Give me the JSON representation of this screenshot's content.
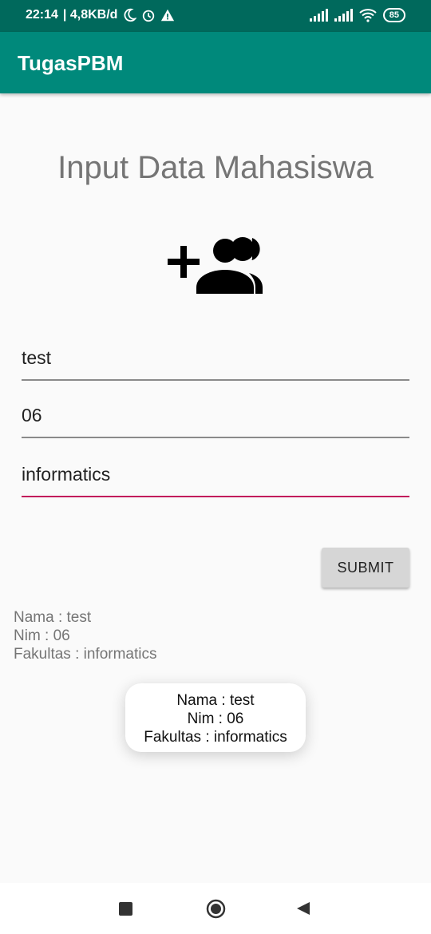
{
  "status_bar": {
    "time": "22:14",
    "net_speed": "| 4,8KB/d",
    "battery": "85",
    "icons": [
      "moon-icon",
      "alarm-icon",
      "warning-icon",
      "signal-icon",
      "signal-icon",
      "wifi-icon",
      "battery-icon"
    ]
  },
  "app_bar": {
    "title": "TugasPBM"
  },
  "main": {
    "title": "Input Data Mahasiswa",
    "hero_icon": "add-group-icon",
    "fields": [
      {
        "value": "test"
      },
      {
        "value": "06"
      },
      {
        "value": "informatics"
      }
    ],
    "submit_label": "SUBMIT",
    "output": {
      "nama": "Nama : test",
      "nim": "Nim : 06",
      "fakultas": "Fakultas : informatics"
    }
  },
  "toast": {
    "nama": "Nama : test",
    "nim": "Nim : 06",
    "fakultas": "Fakultas : informatics"
  },
  "nav_bar": {
    "icons": [
      "recents-icon",
      "home-icon",
      "back-icon"
    ]
  },
  "colors": {
    "status_bar": "#00695c",
    "app_bar": "#00897b",
    "accent": "#c2185b"
  }
}
